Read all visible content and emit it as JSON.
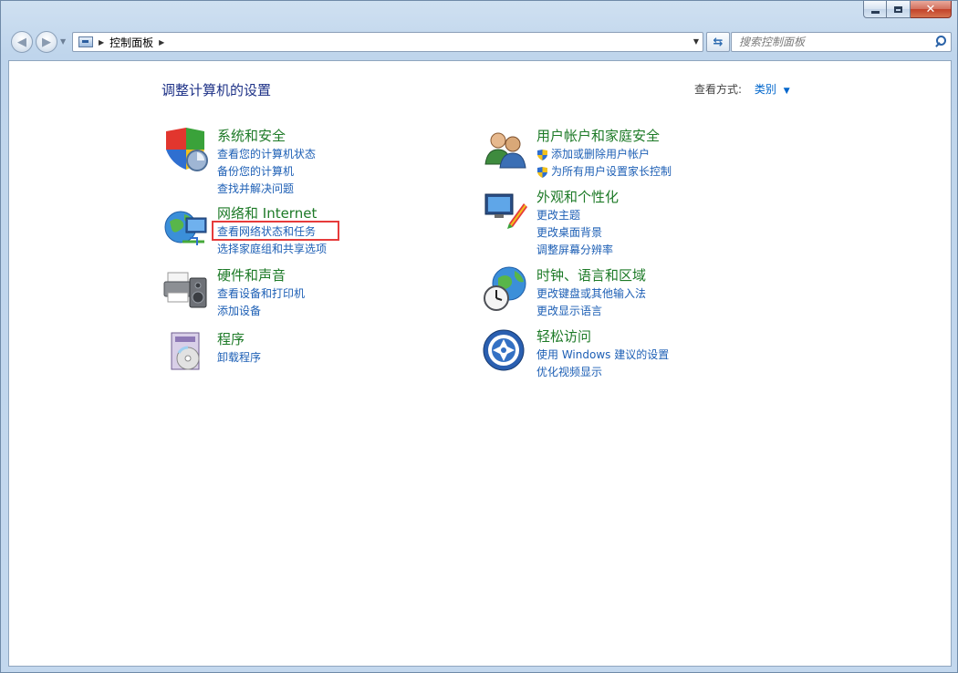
{
  "address_bar": {
    "path": "控制面板"
  },
  "search": {
    "placeholder": "搜索控制面板"
  },
  "page": {
    "title": "调整计算机的设置",
    "view_by_label": "查看方式:",
    "view_by_value": "类别"
  },
  "categories": {
    "system_security": {
      "title": "系统和安全",
      "links": [
        "查看您的计算机状态",
        "备份您的计算机",
        "查找并解决问题"
      ]
    },
    "network": {
      "title": "网络和 Internet",
      "links": [
        "查看网络状态和任务",
        "选择家庭组和共享选项"
      ]
    },
    "hardware": {
      "title": "硬件和声音",
      "links": [
        "查看设备和打印机",
        "添加设备"
      ]
    },
    "programs": {
      "title": "程序",
      "links": [
        "卸载程序"
      ]
    },
    "user_accounts": {
      "title": "用户帐户和家庭安全",
      "links": [
        "添加或删除用户帐户",
        "为所有用户设置家长控制"
      ]
    },
    "appearance": {
      "title": "外观和个性化",
      "links": [
        "更改主题",
        "更改桌面背景",
        "调整屏幕分辨率"
      ]
    },
    "clock_region": {
      "title": "时钟、语言和区域",
      "links": [
        "更改键盘或其他输入法",
        "更改显示语言"
      ]
    },
    "ease_access": {
      "title": "轻松访问",
      "links": [
        "使用 Windows 建议的设置",
        "优化视频显示"
      ]
    }
  },
  "colors": {
    "category_title": "#1d7a27",
    "link": "#1d5fb5",
    "page_title": "#1e3287",
    "highlight_box": "#e63b3b"
  }
}
